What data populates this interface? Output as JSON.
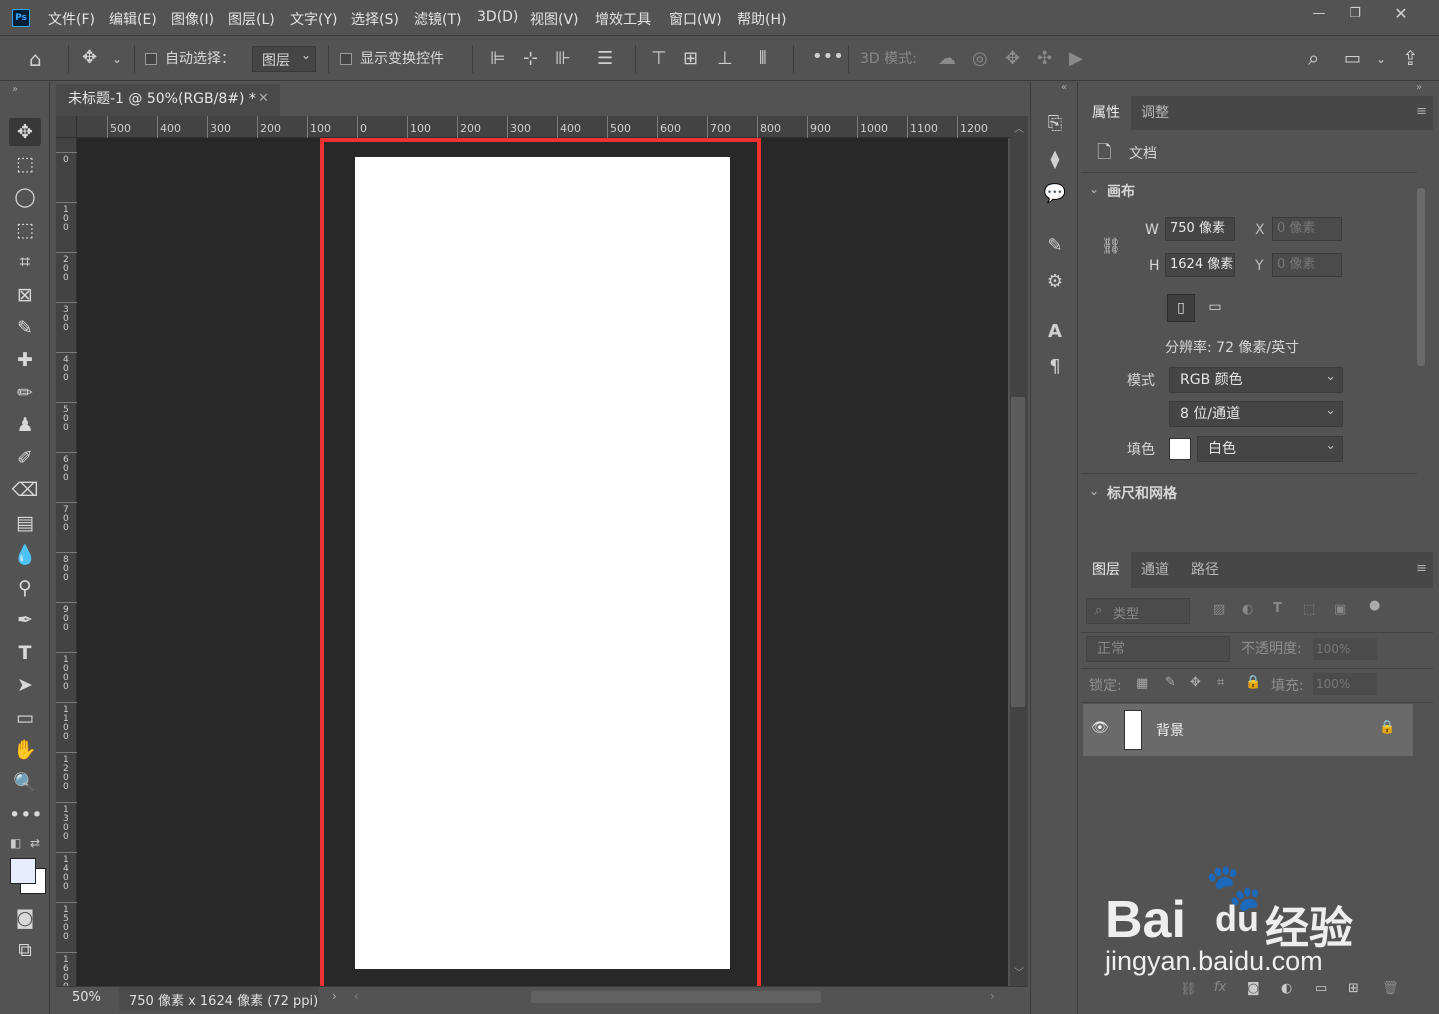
{
  "menubar": {
    "logo": "Ps",
    "items": [
      "文件(F)",
      "编辑(E)",
      "图像(I)",
      "图层(L)",
      "文字(Y)",
      "选择(S)",
      "滤镜(T)",
      "3D(D)",
      "视图(V)",
      "增效工具",
      "窗口(W)",
      "帮助(H)"
    ]
  },
  "options": {
    "auto_select_label": "自动选择：",
    "auto_select_target": "图层",
    "show_transform_label": "显示变换控件",
    "threed_mode_label": "3D 模式:"
  },
  "document": {
    "tab_title": "未标题-1 @ 50%(RGB/8#) *",
    "zoom": "50%",
    "status": "750 像素 x 1624 像素 (72 ppi)"
  },
  "ruler": {
    "h_labels": [
      "500",
      "400",
      "300",
      "200",
      "100",
      "0",
      "100",
      "200",
      "300",
      "400",
      "500",
      "600",
      "700",
      "800",
      "900",
      "1000",
      "1100",
      "1200"
    ],
    "v_labels": [
      "0",
      "1\n0\n0",
      "2\n0\n0",
      "3\n0\n0",
      "4\n0\n0",
      "5\n0\n0",
      "6\n0\n0",
      "7\n0\n0",
      "8\n0\n0",
      "9\n0\n0",
      "1\n0\n0\n0",
      "1\n1\n0\n0",
      "1\n2\n0\n0",
      "1\n3\n0\n0",
      "1\n4\n0\n0",
      "1\n5\n0\n0",
      "1\n6\n0\n0"
    ]
  },
  "properties": {
    "tabs": [
      "属性",
      "调整"
    ],
    "doc_label": "文档",
    "canvas_section": "画布",
    "w_label": "W",
    "w_value": "750 像素",
    "h_label": "H",
    "h_value": "1624 像素",
    "x_label": "X",
    "x_value": "0 像素",
    "y_label": "Y",
    "y_value": "0 像素",
    "resolution": "分辨率: 72 像素/英寸",
    "mode_label": "模式",
    "mode_value": "RGB 颜色",
    "depth_value": "8 位/通道",
    "fill_label": "填色",
    "fill_value": "白色",
    "rulers_section": "标尺和网格"
  },
  "layers": {
    "tabs": [
      "图层",
      "通道",
      "路径"
    ],
    "filter_placeholder": "类型",
    "blend_mode": "正常",
    "opacity_label": "不透明度:",
    "opacity_value": "100%",
    "lock_label": "锁定:",
    "fill_label": "填充:",
    "fill_value": "100%",
    "layer_name": "背景"
  },
  "watermark": {
    "brand": "Bai",
    "brand2": "du",
    "brand_cn": "经验",
    "url": "jingyan.baidu.com"
  },
  "colors": {
    "highlight": "#ef3131",
    "canvas": "#ffffff",
    "workspace": "#282828",
    "chrome": "#535353"
  }
}
